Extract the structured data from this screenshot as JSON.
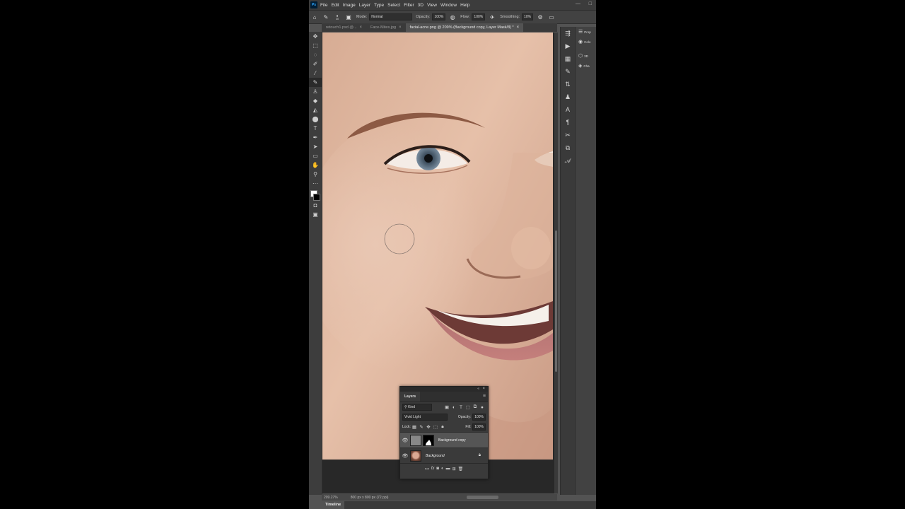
{
  "app": {
    "logo": "Ps"
  },
  "menu": [
    "File",
    "Edit",
    "Image",
    "Layer",
    "Type",
    "Select",
    "Filter",
    "3D",
    "View",
    "Window",
    "Help"
  ],
  "window_controls": {
    "minimize": "—",
    "maximize": "□"
  },
  "options_bar": {
    "brush_size": "30",
    "mode_label": "Mode:",
    "mode_value": "Normal",
    "opacity_label": "Opacity:",
    "opacity_value": "100%",
    "flow_label": "Flow:",
    "flow_value": "100%",
    "smoothing_label": "Smoothing:",
    "smoothing_value": "10%"
  },
  "tabs": [
    {
      "label": "retouch1.psd @...",
      "active": false
    },
    {
      "label": "Face-Mites.jpg",
      "active": false
    },
    {
      "label": "facial-acne.png @ 209% (Background copy, Layer Mask/8) *",
      "active": true
    }
  ],
  "tools": [
    "move-icon",
    "marquee-icon",
    "lasso-icon",
    "quick-select-icon",
    "eyedropper-icon",
    "brush-icon",
    "stamp-icon",
    "eraser-icon",
    "gradient-icon",
    "dodge-icon",
    "type-icon",
    "pen-icon",
    "path-select-icon",
    "rectangle-icon",
    "hand-icon",
    "zoom-icon",
    "more-icon"
  ],
  "status": {
    "zoom": "209.27%",
    "doc_size": "800 px x 800 px (72 ppi)"
  },
  "timeline": {
    "label": "Timeline"
  },
  "right_panels": [
    {
      "icon": "properties-icon",
      "label": "Prop"
    },
    {
      "icon": "color-icon",
      "label": "Colo"
    },
    {
      "icon": "3d-icon",
      "label": "3D"
    },
    {
      "icon": "channels-icon",
      "label": "Cha"
    }
  ],
  "layers_panel": {
    "title": "Layers",
    "filter_kind": "Kind",
    "blend_mode": "Vivid Light",
    "opacity_label": "Opacity:",
    "opacity_value": "100%",
    "lock_label": "Lock:",
    "fill_label": "Fill:",
    "fill_value": "100%",
    "layers": [
      {
        "name": "Background copy",
        "selected": true,
        "has_mask": true
      },
      {
        "name": "Background",
        "selected": false,
        "locked": true
      }
    ],
    "footer_icons": [
      "link-icon",
      "fx-icon",
      "mask-icon",
      "adjustment-icon",
      "group-icon",
      "new-layer-icon",
      "delete-icon"
    ]
  },
  "colors": {
    "foreground": "#ffffff",
    "background": "#000000",
    "ui_dark": "#3c3c3c",
    "ui_mid": "#535353"
  }
}
